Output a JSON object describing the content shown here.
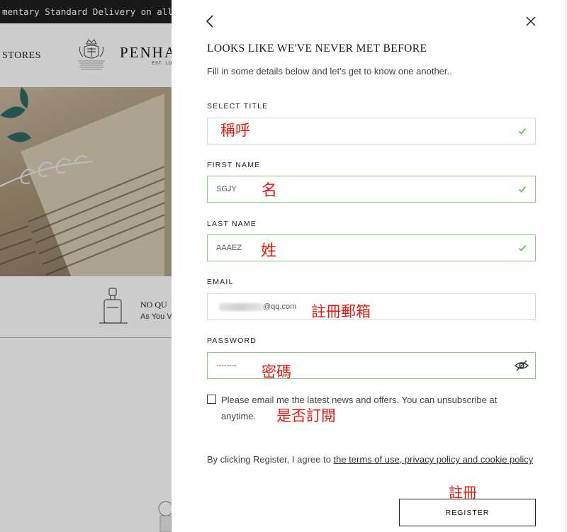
{
  "background": {
    "banner_text": "mentary Standard Delivery on all UK or",
    "nav_stores": "STORES",
    "brand_name": "PENHA",
    "brand_est": "EST. LO",
    "usp_title": "NO QU",
    "usp_subtitle": "As You V"
  },
  "modal": {
    "heading": "LOOKS LIKE WE'VE NEVER MET BEFORE",
    "subheading": "Fill in some details below and let's get to know one another..",
    "fields": {
      "title": {
        "label": "SELECT TITLE",
        "value": "",
        "annotation": "稱呼"
      },
      "first_name": {
        "label": "FIRST NAME",
        "value": "SGJY",
        "annotation": "名"
      },
      "last_name": {
        "label": "LAST NAME",
        "value": "AAAEZ",
        "annotation": "姓"
      },
      "email": {
        "label": "EMAIL",
        "value": "@qq.com",
        "annotation": "註冊郵箱"
      },
      "password": {
        "label": "PASSWORD",
        "value": "............",
        "annotation": "密碼"
      }
    },
    "newsletter": {
      "text": "Please email me the latest news and offers. You can unsubscribe at anytime.",
      "annotation": "是否訂閱"
    },
    "terms": {
      "prefix": "By clicking Register, I agree to ",
      "link": "the terms of use, privacy policy and cookie policy"
    },
    "register": {
      "label": "REGISTER",
      "annotation": "註冊"
    }
  },
  "colors": {
    "valid_border": "#7fcf74",
    "check": "#4caf50",
    "annotation": "#e8190e"
  },
  "icons": [
    "chevron-left-icon",
    "close-icon",
    "checkmark-icon",
    "eye-hidden-icon",
    "crest-logo-icon",
    "perfume-bottle-icon"
  ]
}
